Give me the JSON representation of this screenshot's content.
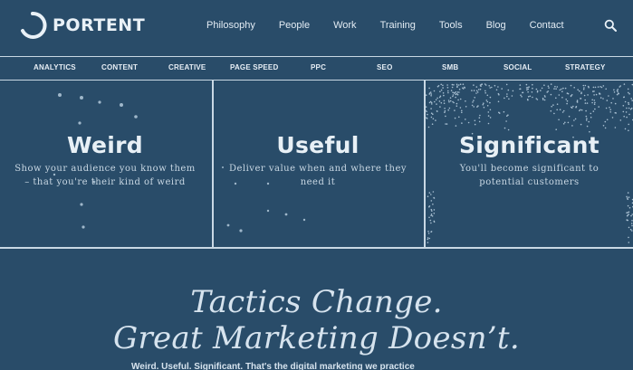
{
  "brand": {
    "name": "PORTENT"
  },
  "nav": {
    "items": [
      "Philosophy",
      "People",
      "Work",
      "Training",
      "Tools",
      "Blog",
      "Contact"
    ]
  },
  "subnav": {
    "items": [
      "ANALYTICS",
      "CONTENT",
      "CREATIVE",
      "PAGE SPEED",
      "PPC",
      "SEO",
      "SMB",
      "SOCIAL",
      "STRATEGY"
    ]
  },
  "panels": [
    {
      "title": "Weird",
      "desc": "Show your audience you know them – that you're their kind of weird"
    },
    {
      "title": "Useful",
      "desc": "Deliver value when and where they need it"
    },
    {
      "title": "Significant",
      "desc": "You'll become significant to potential customers"
    }
  ],
  "hero": {
    "line1": "Tactics Change.",
    "line2": "Great Marketing Doesn’t.",
    "tagline": "Weird. Useful. Significant. That's the digital marketing we practice"
  },
  "colors": {
    "background": "#294c69",
    "divider": "#c9d8e4",
    "text": "#e3ecf4"
  }
}
